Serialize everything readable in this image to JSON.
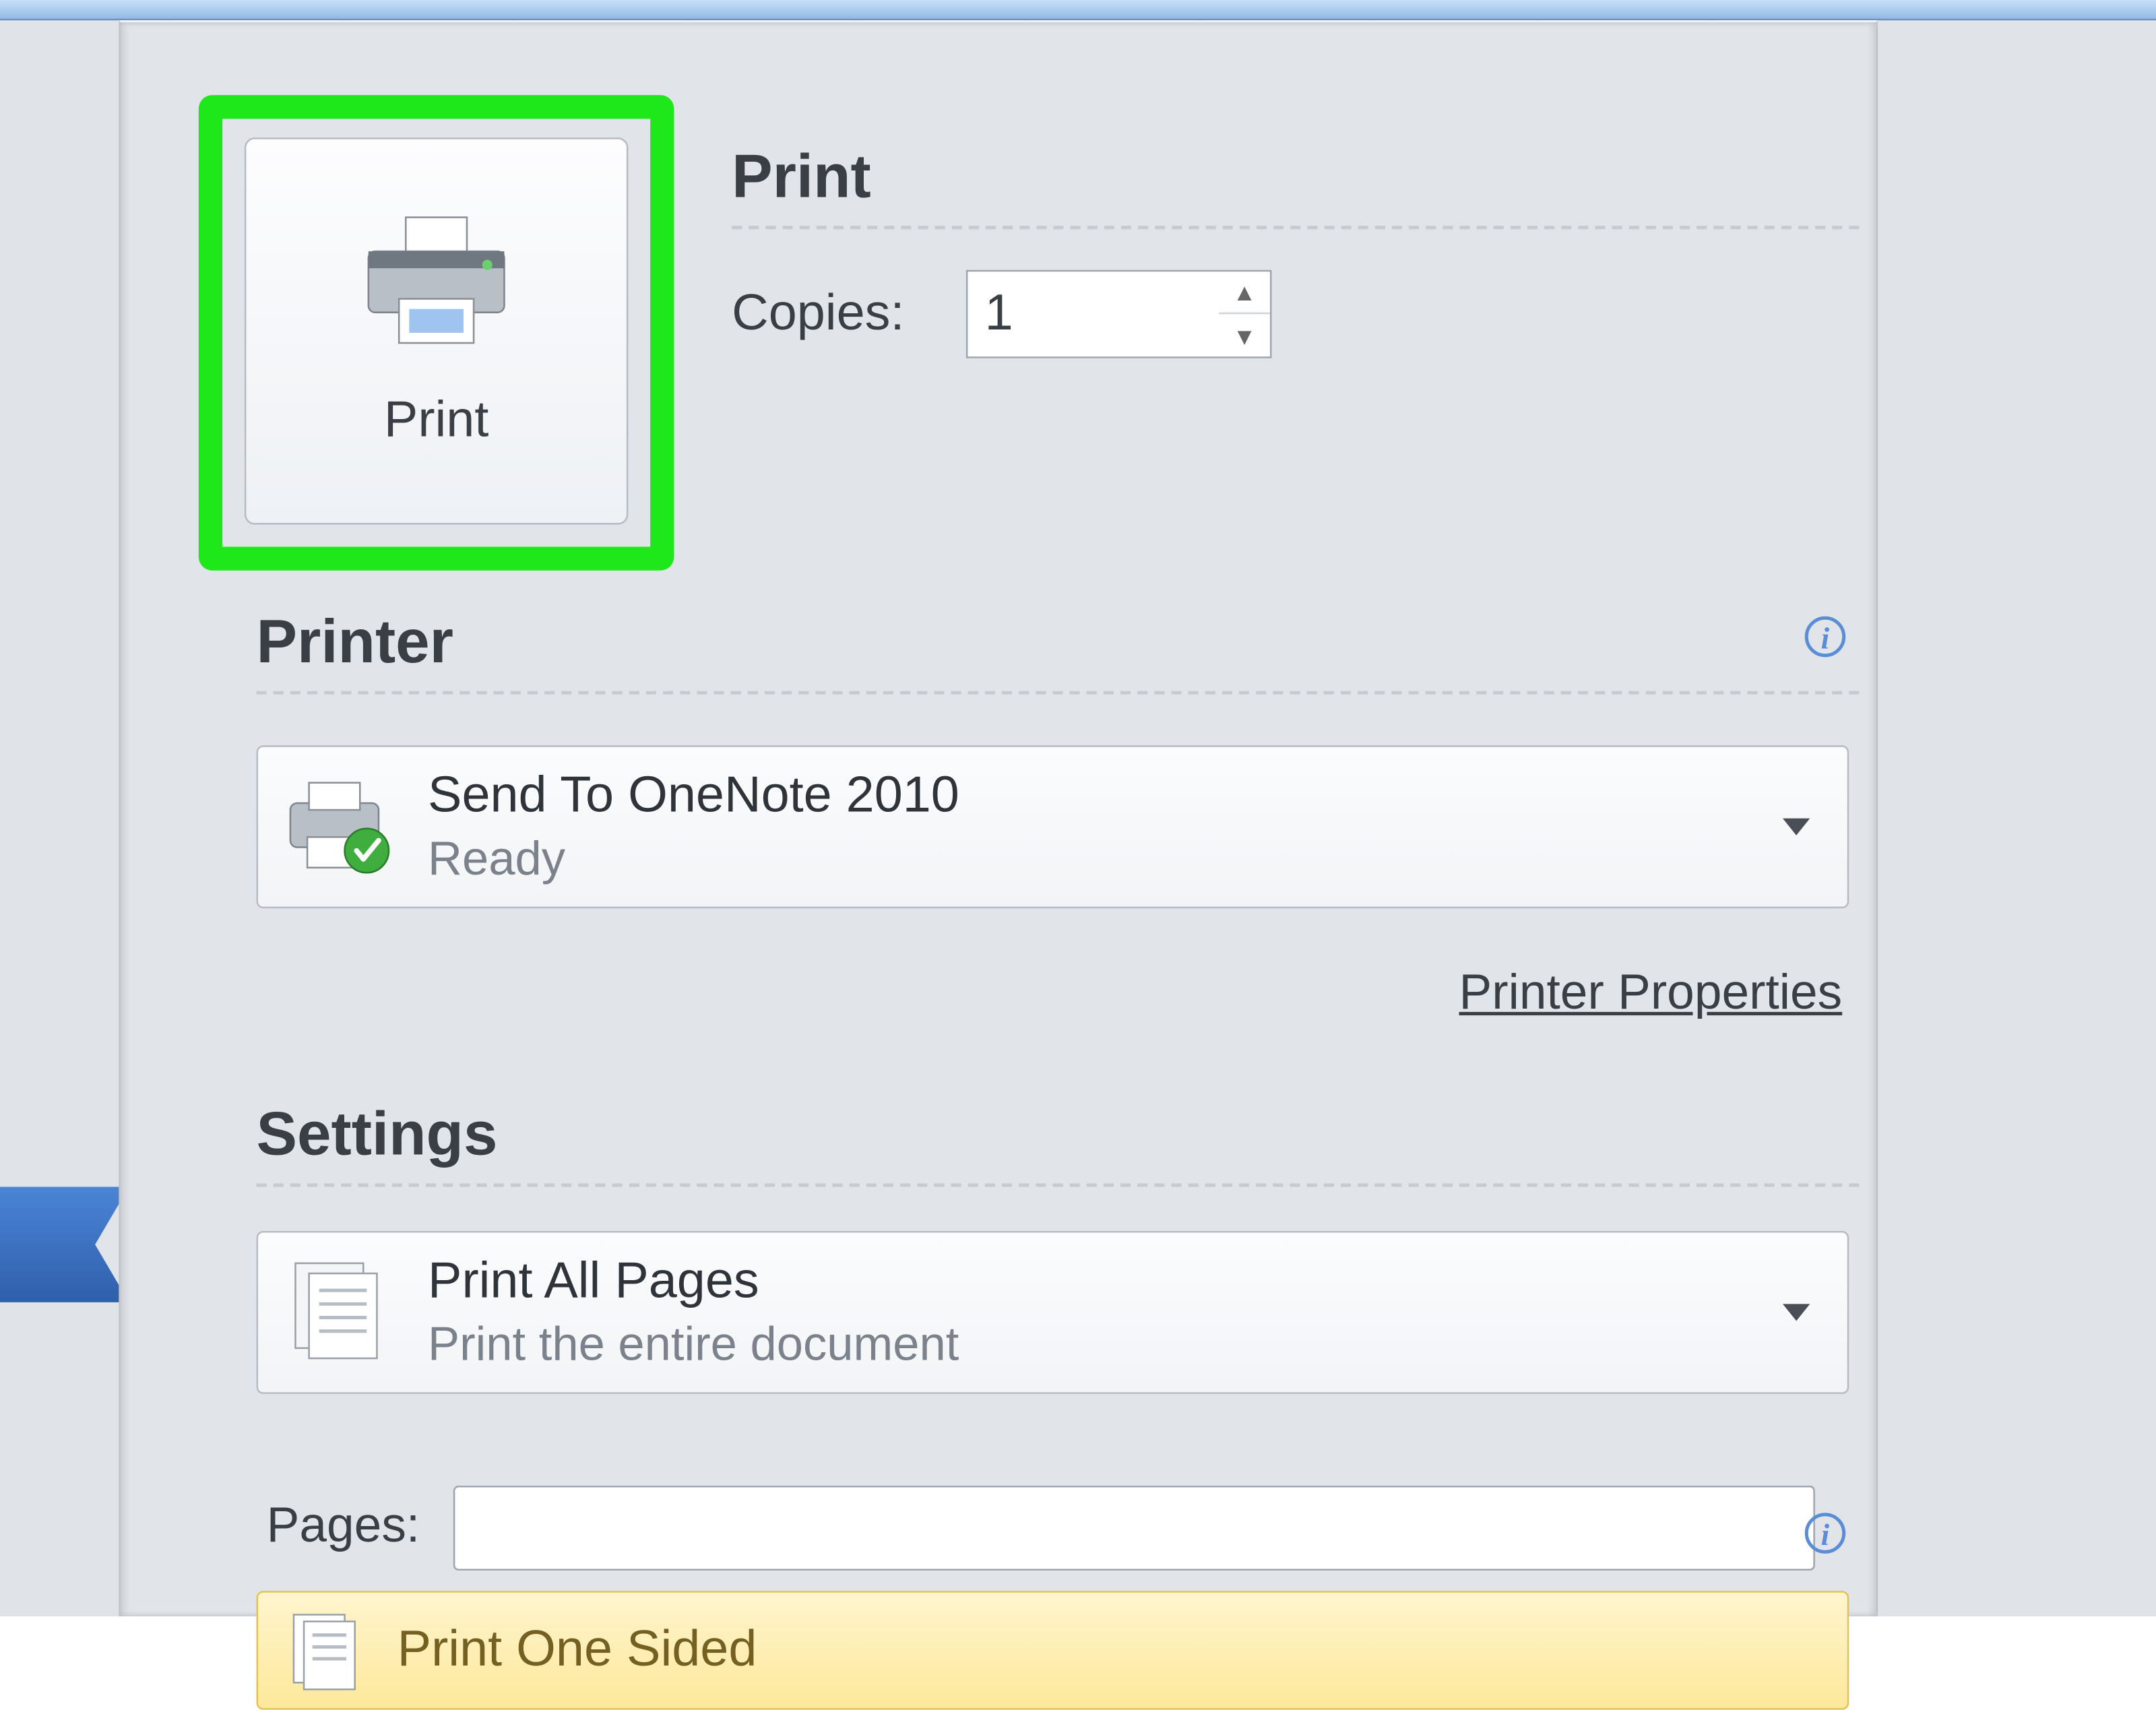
{
  "print": {
    "section_title": "Print",
    "button_label": "Print",
    "copies_label": "Copies:",
    "copies_value": "1"
  },
  "printer": {
    "heading": "Printer",
    "selected_name": "Send To OneNote 2010",
    "selected_status": "Ready",
    "properties_link": "Printer Properties"
  },
  "settings": {
    "heading": "Settings",
    "page_range": {
      "title": "Print All Pages",
      "subtitle": "Print the entire document"
    },
    "pages_label": "Pages:",
    "pages_value": "",
    "sided": {
      "title": "Print One Sided"
    }
  },
  "icons": {
    "info_glyph": "i"
  }
}
